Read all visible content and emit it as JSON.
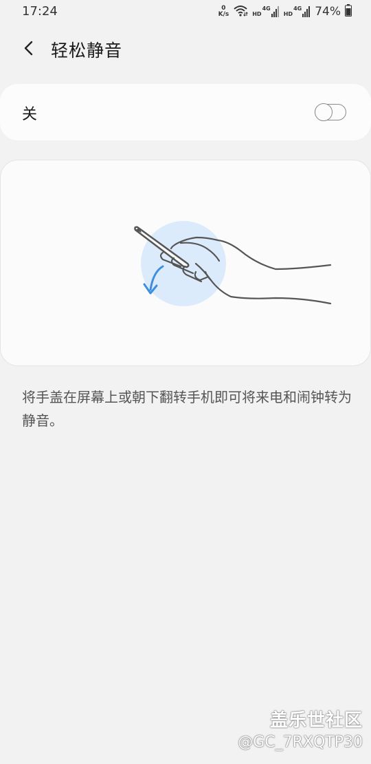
{
  "status_bar": {
    "time": "17:24",
    "net_speed_value": "0",
    "net_speed_unit": "K/s",
    "sim1_hd": "HD",
    "sim1_net": "4G",
    "sim2_hd": "HD",
    "sim2_net": "4G",
    "battery_percent": "74%"
  },
  "header": {
    "title": "轻松静音"
  },
  "toggle": {
    "label": "关",
    "state": "off"
  },
  "description": "将手盖在屏幕上或朝下翻转手机即可将来电和闹钟转为静音。",
  "watermark": {
    "brand": "盖乐世社区",
    "user": "@GC_7RXQTP30"
  },
  "colors": {
    "background": "#f2f2f2",
    "card": "#fcfcfc",
    "accent_blue": "#3d8ee0",
    "illus_circle": "#dcebfb"
  }
}
